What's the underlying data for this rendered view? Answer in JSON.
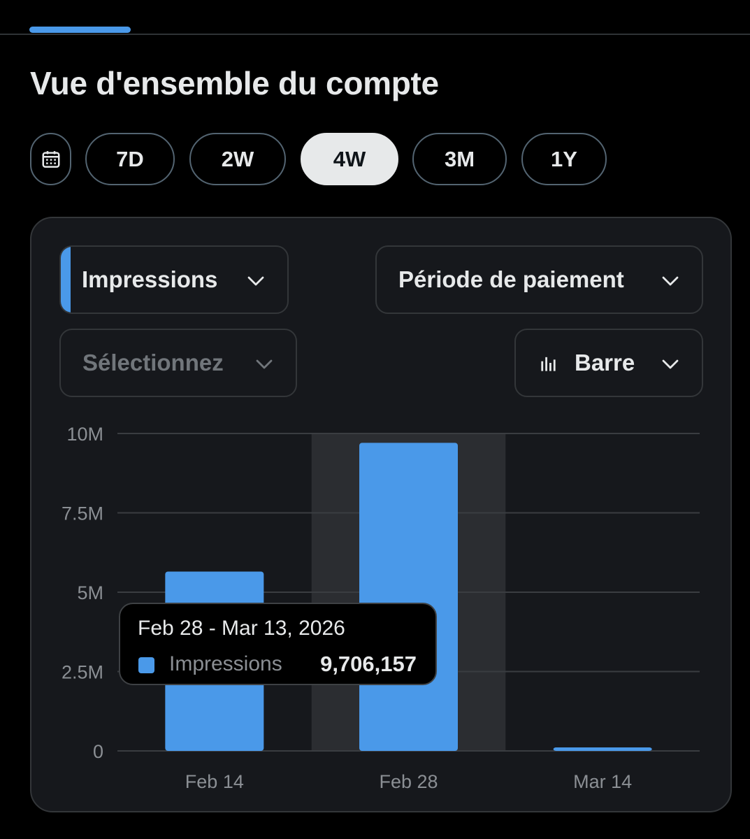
{
  "page": {
    "title": "Vue d'ensemble du compte"
  },
  "range": {
    "buttons": [
      "7D",
      "2W",
      "4W",
      "3M",
      "1Y"
    ],
    "selected": "4W"
  },
  "controls": {
    "metric": "Impressions",
    "period": "Période de paiement",
    "compare_placeholder": "Sélectionnez",
    "chart_type": "Barre"
  },
  "colors": {
    "accent": "#4a99e9",
    "card_bg": "#16181c",
    "highlight_band": "#2b2d31"
  },
  "tooltip": {
    "date_range": "Feb 28 - Mar 13, 2026",
    "series": "Impressions",
    "value": "9,706,157"
  },
  "chart_data": {
    "type": "bar",
    "categories": [
      "Feb 14",
      "Feb 28",
      "Mar 14"
    ],
    "series": [
      {
        "name": "Impressions",
        "values": [
          5650000,
          9706157,
          90000
        ],
        "color": "#4a99e9"
      }
    ],
    "ylim": [
      0,
      10000000
    ],
    "yticks": [
      0,
      2500000,
      5000000,
      7500000,
      10000000
    ],
    "ytick_labels": [
      "0",
      "2.5M",
      "5M",
      "7.5M",
      "10M"
    ],
    "highlighted_category": "Feb 28",
    "grid": "horizontal",
    "title": "",
    "xlabel": "",
    "ylabel": ""
  }
}
